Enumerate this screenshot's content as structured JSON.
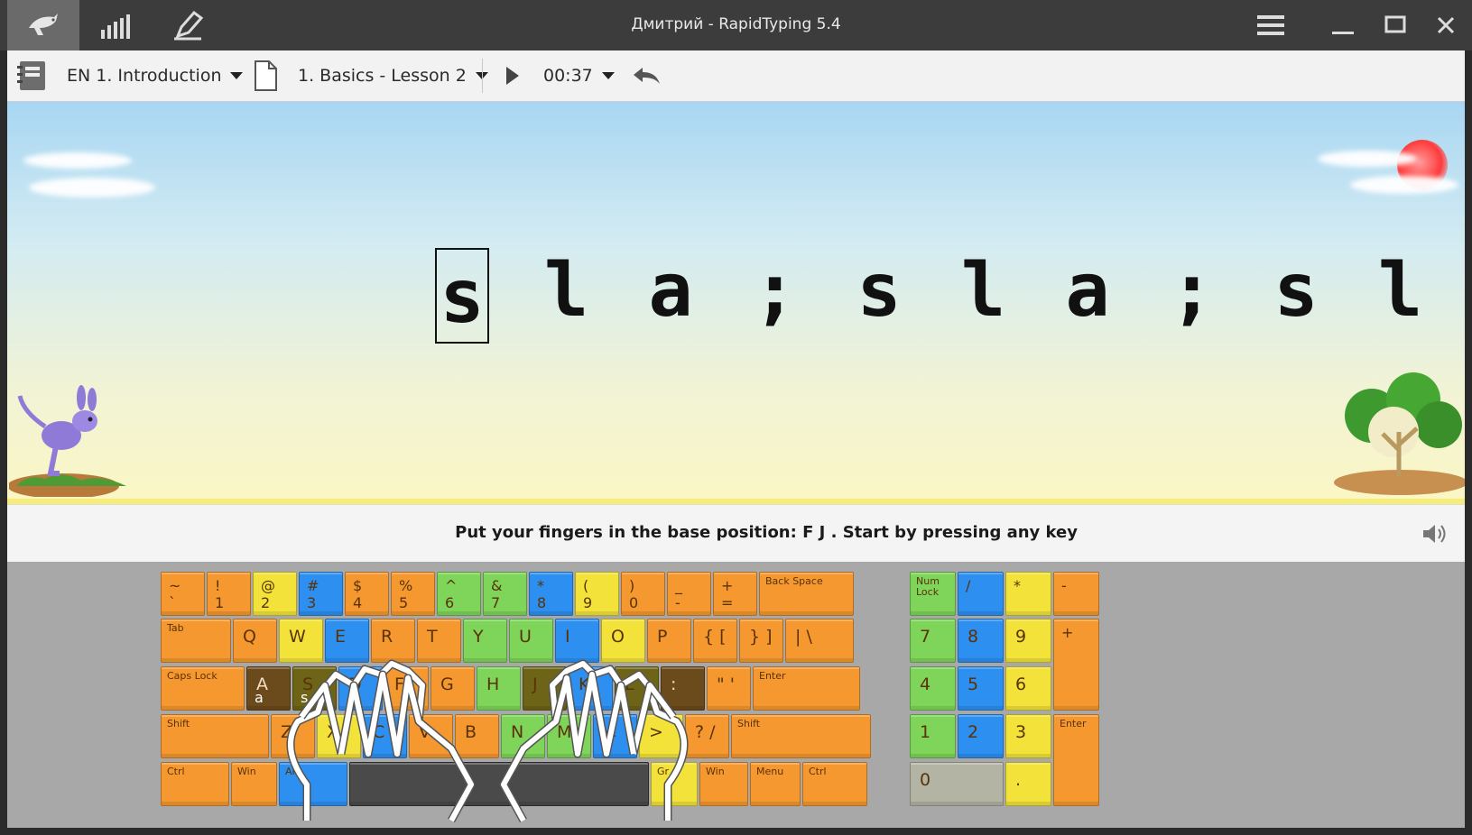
{
  "window": {
    "title": "Дмитрий - RapidTyping 5.4"
  },
  "titlebar": {
    "buttons": [
      "lesson-icon",
      "statistics-icon",
      "editor-icon"
    ],
    "controls": [
      "menu-icon",
      "minimize-icon",
      "maximize-icon",
      "close-icon"
    ]
  },
  "toolbar": {
    "course": "EN 1. Introduction",
    "lesson": "1. Basics - Lesson 2",
    "time": "00:37"
  },
  "lesson": {
    "characters": [
      "s",
      "l",
      "a",
      ";",
      "s",
      "l",
      "a",
      ";",
      "s",
      "l"
    ],
    "current_index": 0
  },
  "instruction": "Put your fingers in the base position:  F  J .  Start by pressing any key",
  "keyboard": {
    "row0": [
      {
        "t": "~",
        "b": "`"
      },
      {
        "t": "!",
        "b": "1"
      },
      {
        "t": "@",
        "b": "2"
      },
      {
        "t": "#",
        "b": "3"
      },
      {
        "t": "$",
        "b": "4"
      },
      {
        "t": "%",
        "b": "5"
      },
      {
        "t": "^",
        "b": "6"
      },
      {
        "t": "&",
        "b": "7"
      },
      {
        "t": "*",
        "b": "8"
      },
      {
        "t": "(",
        "b": "9"
      },
      {
        "t": ")",
        "b": "0"
      },
      {
        "t": "_",
        "b": "-"
      },
      {
        "t": "+",
        "b": "="
      },
      {
        "t": "Back Space",
        "b": ""
      }
    ],
    "row1": [
      "Tab",
      "Q",
      "W",
      "E",
      "R",
      "T",
      "Y",
      "U",
      "I",
      "O",
      "P",
      "{ [",
      "} ]",
      "| \\"
    ],
    "row2": [
      "Caps Lock",
      "A",
      "S",
      "D",
      "F",
      "G",
      "H",
      "J",
      "K",
      "L",
      ":",
      "\" '",
      "Enter"
    ],
    "row2_lower": {
      "A": "a",
      "S": "s"
    },
    "row3": [
      "Shift",
      "Z",
      "X",
      "C",
      "V",
      "B",
      "N",
      "M",
      "<",
      ">",
      "? /",
      "Shift"
    ],
    "row4": [
      "Ctrl",
      "Win",
      "Alt",
      "",
      "Gr",
      "Win",
      "Menu",
      "Ctrl"
    ],
    "numpad": {
      "row0": [
        "Num Lock",
        "/",
        "*",
        "-"
      ],
      "row1": [
        "7",
        "8",
        "9",
        "+"
      ],
      "row2": [
        "4",
        "5",
        "6"
      ],
      "row3": [
        "1",
        "2",
        "3",
        "Enter"
      ],
      "row4": [
        "0",
        "."
      ]
    }
  },
  "colors": {
    "orange": "#f4982f",
    "yellow": "#f2e23a",
    "green": "#7fd45a",
    "blue": "#2d8ff0",
    "highlight_brown": "#6b4a1c",
    "highlight_olive": "#6e6418"
  }
}
